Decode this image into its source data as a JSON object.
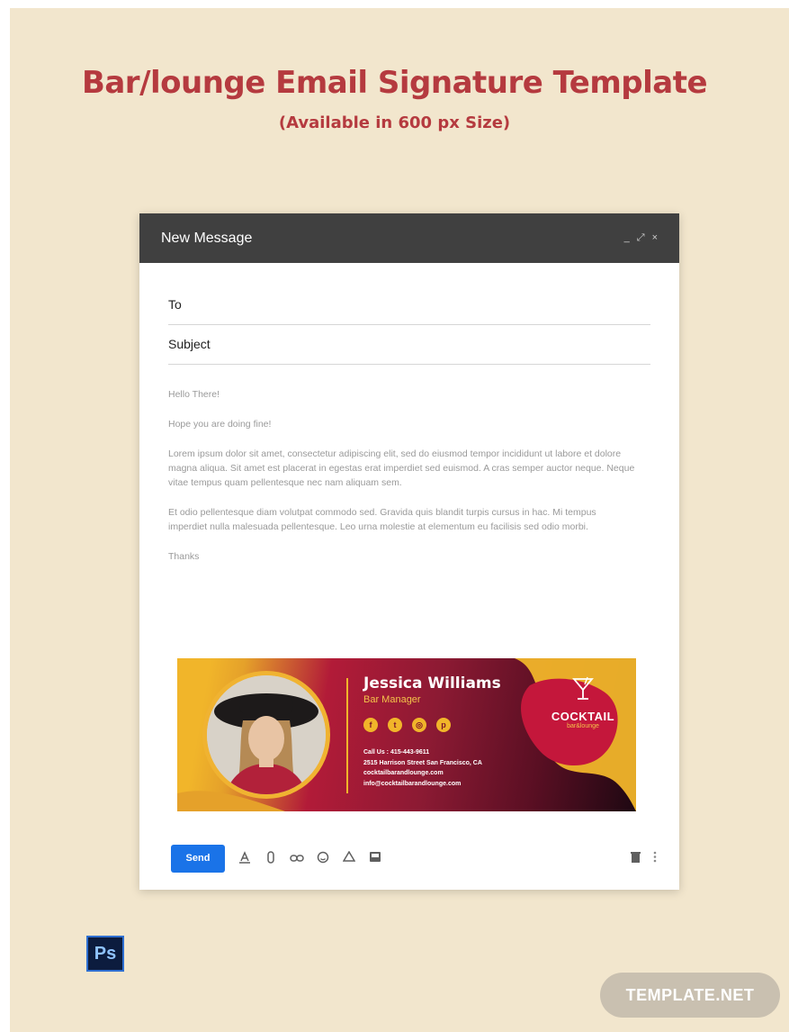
{
  "poster": {
    "title": "Bar/lounge Email Signature Template",
    "subtitle": "(Available in 600 px Size)"
  },
  "compose": {
    "window_title": "New Message",
    "controls": [
      "_",
      "⤢",
      "×"
    ],
    "to_label": "To",
    "subject_label": "Subject",
    "body": [
      "Hello There!",
      "Hope you are doing fine!",
      "Lorem ipsum dolor sit amet, consectetur adipiscing elit, sed do eiusmod tempor incididunt ut labore et dolore magna aliqua. Sit amet est placerat in egestas erat imperdiet sed euismod. A cras semper auctor neque. Neque vitae tempus quam pellentesque nec nam aliquam sem.",
      " Et odio pellentesque diam volutpat commodo sed. Gravida quis blandit turpis cursus in hac. Mi tempus imperdiet nulla malesuada pellentesque. Leo urna molestie at elementum eu facilisis sed odio morbi.",
      "Thanks"
    ],
    "send_label": "Send"
  },
  "signature": {
    "name": "Jessica Williams",
    "role": "Bar Manager",
    "social": [
      "f",
      "t",
      "◎",
      "p"
    ],
    "call": "Call Us : 415-443-9611",
    "address": "2515 Harrison Street San Francisco, CA",
    "website": "cocktailbarandlounge.com",
    "email": "info@cocktailbarandlounge.com",
    "logo_main": "COCKTAIL",
    "logo_sub": "bar&lounge"
  },
  "badges": {
    "ps": "Ps",
    "brand": "TEMPLATE.NET"
  },
  "colors": {
    "title": "#b53a3f",
    "background": "#f2e6cd",
    "header": "#404040",
    "send": "#1a73e8",
    "accent_yellow": "#f1b52a",
    "accent_red": "#b21b38"
  }
}
